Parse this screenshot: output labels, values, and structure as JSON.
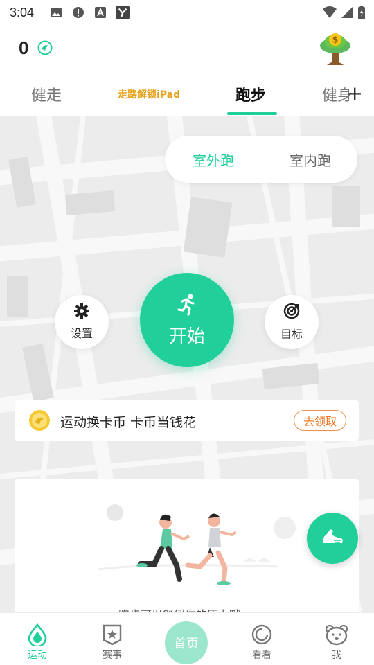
{
  "status_bar": {
    "time": "3:04",
    "icons": [
      "image-icon",
      "alert-icon",
      "a-badge-icon",
      "y-app-icon"
    ],
    "right_icons": [
      "wifi-icon",
      "signal-icon",
      "battery-icon"
    ]
  },
  "header": {
    "coin_count": "0",
    "coin_icon": "leaf-coin-icon",
    "tree_icon": "money-tree-icon"
  },
  "tabs": [
    {
      "label": "健走",
      "active": false
    },
    {
      "label": "走路解锁iPad",
      "active": false,
      "promo": true
    },
    {
      "label": "跑步",
      "active": true
    },
    {
      "label": "健身",
      "active": false
    }
  ],
  "tab_more": "+",
  "run_modes": {
    "outdoor": "室外跑",
    "indoor": "室内跑",
    "selected": "outdoor"
  },
  "controls": {
    "settings_label": "设置",
    "start_label": "开始",
    "target_label": "目标"
  },
  "promo": {
    "text": "运动换卡币 卡币当钱花",
    "button": "去领取"
  },
  "card": {
    "caption": "跑步可以舒缓你的压力哦"
  },
  "bottom_nav": [
    {
      "label": "运动",
      "icon": "drop-icon",
      "active": true
    },
    {
      "label": "赛事",
      "icon": "badge-star-icon",
      "active": false
    },
    {
      "label": "首页",
      "icon": "home-icon",
      "active": false
    },
    {
      "label": "看看",
      "icon": "swirl-icon",
      "active": false
    },
    {
      "label": "我",
      "icon": "bear-icon",
      "active": false
    }
  ],
  "colors": {
    "accent": "#20cf9a",
    "promo_orange": "#f07a2a",
    "promo_tab": "#e6a21a",
    "map_bg": "#ececec"
  }
}
